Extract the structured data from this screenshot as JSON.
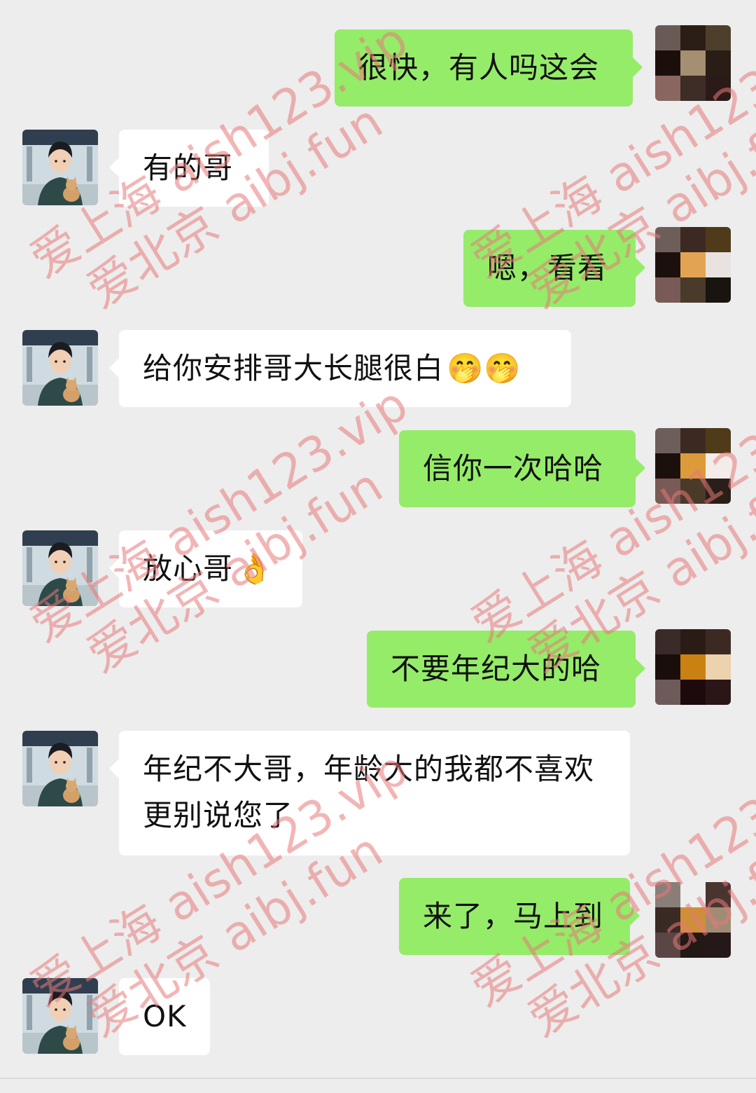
{
  "messages": [
    {
      "side": "right",
      "text": "很快，有人吗这会"
    },
    {
      "side": "left",
      "text": "有的哥"
    },
    {
      "side": "right",
      "text": "嗯，看看"
    },
    {
      "side": "left",
      "text": "给你安排哥大长腿很白",
      "emoji": "🤭🤭"
    },
    {
      "side": "right",
      "text": "信你一次哈哈"
    },
    {
      "side": "left",
      "text": "放心哥",
      "emoji": "👌"
    },
    {
      "side": "right",
      "text": "不要年纪大的哈"
    },
    {
      "side": "left",
      "text": "年纪不大哥，年龄大的我都不喜欢更别说您了"
    },
    {
      "side": "right",
      "text": "来了，马上到"
    },
    {
      "side": "left",
      "text": "OK"
    }
  ],
  "watermark": {
    "line1": "爱上海 aish123.vip",
    "line2": "爱北京 aibj.fun"
  },
  "colors": {
    "background": "#ededed",
    "bubble_sent": "#95ec69",
    "bubble_received": "#ffffff",
    "watermark": "#e87878"
  },
  "icons": {
    "contact_avatar": "boy-with-cat-avatar",
    "self_avatar": "pixelated-avatar"
  }
}
